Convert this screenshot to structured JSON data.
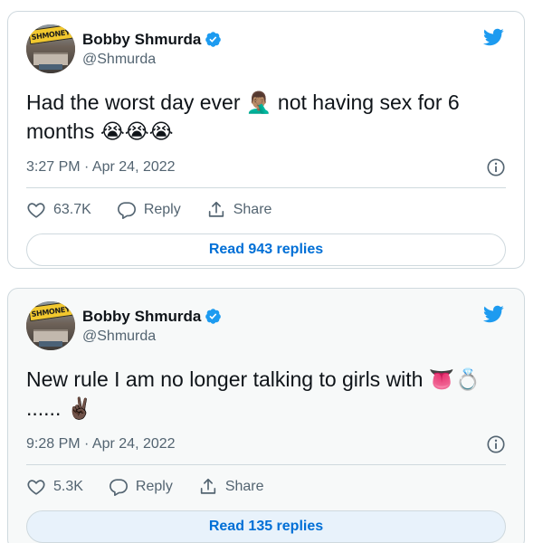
{
  "tweets": [
    {
      "author": {
        "name": "Bobby Shmurda",
        "handle": "@Shmurda",
        "avatar_banner": "SHMONEY"
      },
      "text": "Had the worst day ever 🤦🏽‍♂️ not having sex for 6 months 😭😭😭",
      "time": "3:27 PM · Apr 24, 2022",
      "likes": "63.7K",
      "reply_label": "Reply",
      "share_label": "Share",
      "read_replies_label": "Read 943 replies"
    },
    {
      "author": {
        "name": "Bobby Shmurda",
        "handle": "@Shmurda",
        "avatar_banner": "SHMONEY"
      },
      "text": "New rule I am no longer talking to girls with 👅💍 ...... ✌🏿",
      "time": "9:28 PM · Apr 24, 2022",
      "likes": "5.3K",
      "reply_label": "Reply",
      "share_label": "Share",
      "read_replies_label": "Read 135 replies"
    }
  ],
  "colors": {
    "twitter_blue": "#1d9bf0",
    "link_blue": "#006fd6",
    "secondary_text": "#536471",
    "border": "#cfd9de"
  },
  "icons": [
    "twitter-bird-icon",
    "verified-badge-icon",
    "info-icon",
    "heart-icon",
    "reply-icon",
    "share-icon"
  ]
}
